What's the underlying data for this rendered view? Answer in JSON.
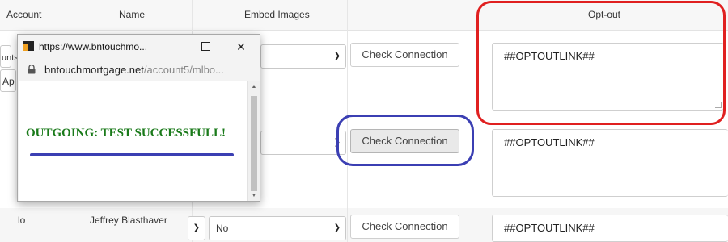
{
  "table": {
    "headers": {
      "account": "Account",
      "name": "Name",
      "embed": "Embed Images",
      "optout": "Opt-out"
    },
    "row1": {
      "account_partial": "unts",
      "account_partial2": "Ap",
      "check_label": "Check Connection",
      "optout_value": "##OPTOUTLINK##"
    },
    "row2": {
      "check_label": "Check Connection",
      "optout_value": "##OPTOUTLINK##"
    },
    "row3": {
      "account": "lo",
      "name": "Jeffrey Blasthaver",
      "embed_value": "No",
      "check_label": "Check Connection",
      "optout_value": "##OPTOUTLINK##"
    }
  },
  "popup": {
    "title": "https://www.bntouchmo...",
    "url_host": "bntouchmortgage.net",
    "url_path": "/account5/mlbo...",
    "message": "OUTGOING: TEST SUCCESSFULL!"
  },
  "colors": {
    "annotation_red": "#e02020",
    "annotation_blue": "#3b3fb3",
    "success_green": "#1a7a1a"
  }
}
